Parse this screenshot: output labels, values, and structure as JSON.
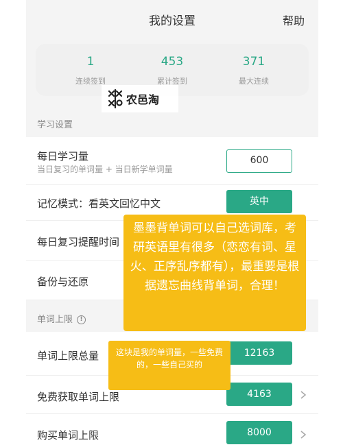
{
  "header": {
    "title": "我的设置",
    "help": "帮助"
  },
  "stats": [
    {
      "value": "1",
      "label": "连续签到"
    },
    {
      "value": "453",
      "label": "累计签到"
    },
    {
      "value": "371",
      "label": "最大连续"
    }
  ],
  "watermark": {
    "text": "农邑淘"
  },
  "study": {
    "section_title": "学习设置",
    "daily": {
      "label": "每日学习量",
      "sub": "当日复习的单词量 + 当日新学单词量",
      "value": "600"
    },
    "memory": {
      "label": "记忆模式：看英文回忆中文",
      "button": "英中"
    },
    "reminder": {
      "label": "每日复习提醒时间"
    },
    "backup": {
      "label": "备份与还原"
    }
  },
  "limits": {
    "section_title": "单词上限",
    "info_icon": "info-icon",
    "total": {
      "label": "单词上限总量",
      "value": "12163"
    },
    "free": {
      "label": "免费获取单词上限",
      "value": "4163"
    },
    "purchase": {
      "label": "购买单词上限",
      "value": "8000"
    }
  },
  "notes": {
    "big": "墨墨背单词可以自己选词库，考研英语里有很多（恋恋有词、星火、正序乱序都有），最重要是根据遗忘曲线背单词，合理！",
    "small": "这块是我的单词量，一些免费的，一些自己买的"
  },
  "colors": {
    "accent": "#2aa886",
    "note": "#f6bd16",
    "background": "#f4f4f4"
  }
}
